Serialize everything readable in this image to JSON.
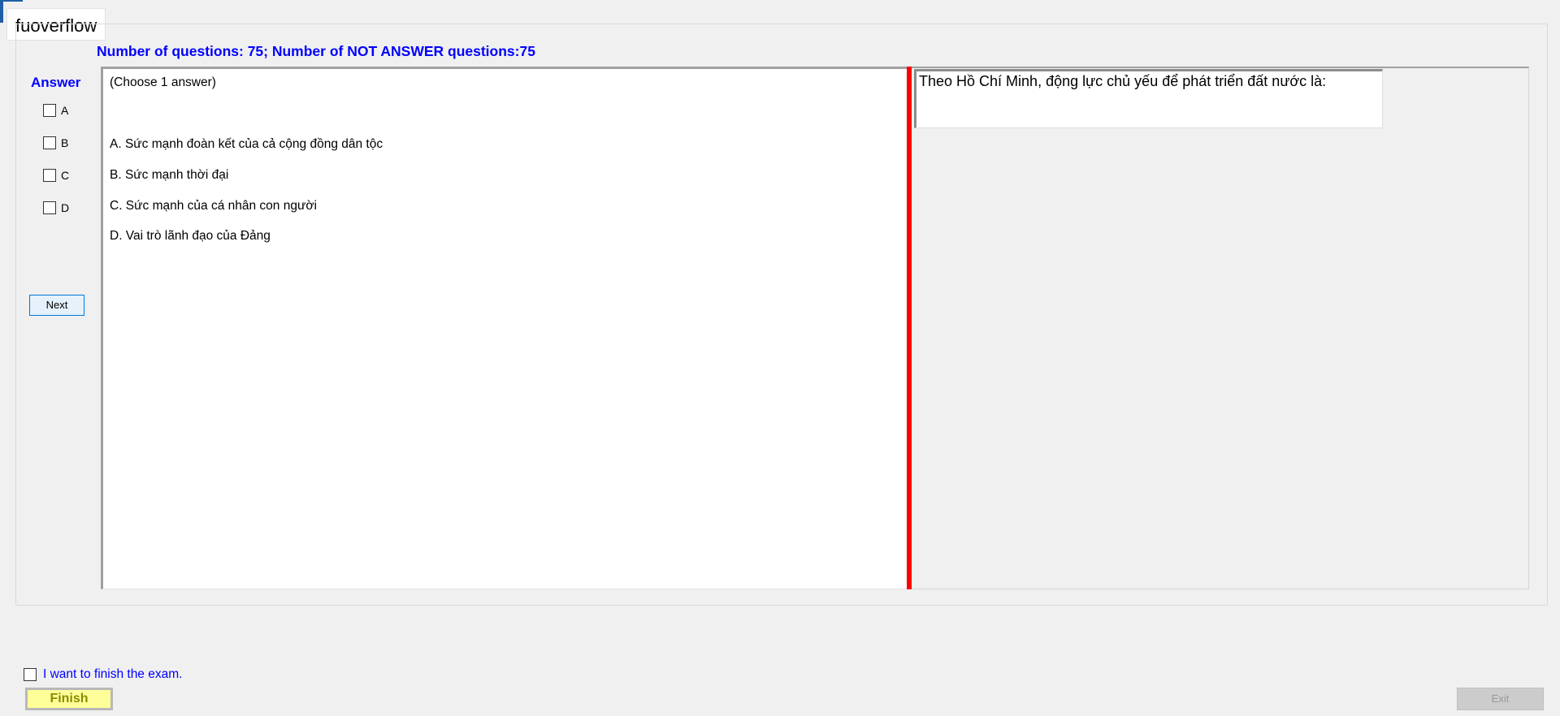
{
  "app": {
    "title": "fuoverflow"
  },
  "exam": {
    "question_count_text": "Number of questions: 75; Number of NOT ANSWER questions:75"
  },
  "answer_panel": {
    "title": "Answer",
    "options": [
      "A",
      "B",
      "C",
      "D"
    ],
    "next_label": "Next"
  },
  "answers": {
    "instruction": "(Choose 1 answer)",
    "options": [
      "A.  Sức mạnh đoàn kết của cả cộng đồng dân tộc",
      "B.  Sức mạnh thời đại",
      "C.  Sức mạnh của cá nhân con người",
      "D.  Vai trò lãnh đạo của Đảng"
    ]
  },
  "question": {
    "text": "Theo Hồ Chí Minh, động lực chủ yếu để phát triển đất nước là:"
  },
  "footer": {
    "finish_checkbox_label": "I want to finish the exam.",
    "finish_label": "Finish",
    "exit_label": "Exit"
  },
  "colors": {
    "accent_blue": "#0000ff",
    "splitter_red": "#ff0000",
    "finish_button_bg": "#ffff99"
  }
}
